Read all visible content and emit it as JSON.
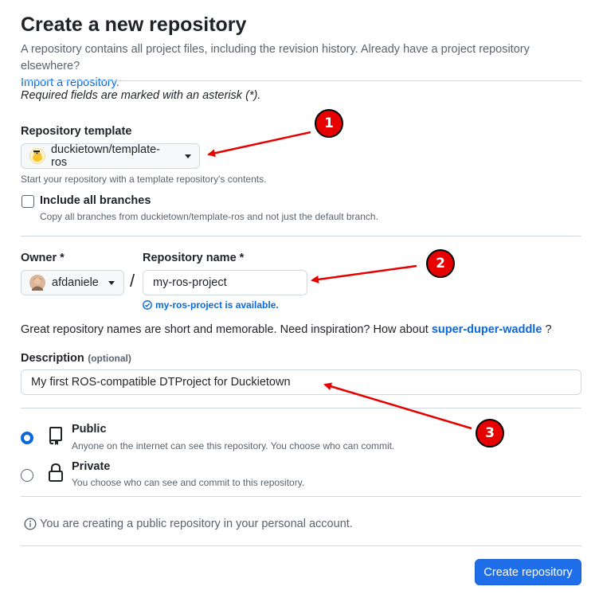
{
  "header": {
    "title": "Create a new repository",
    "intro": "A repository contains all project files, including the revision history. Already have a project repository elsewhere?",
    "import_link": "Import a repository."
  },
  "required_note": "Required fields are marked with an asterisk (*).",
  "template": {
    "label": "Repository template",
    "value": "duckietown/template-ros",
    "hint": "Start your repository with a template repository's contents.",
    "include_branches_label": "Include all branches",
    "include_branches_checked": false,
    "include_branches_hint": "Copy all branches from duckietown/template-ros and not just the default branch."
  },
  "owner": {
    "label": "Owner *",
    "value": "afdaniele"
  },
  "separator": "/",
  "repo_name": {
    "label": "Repository name *",
    "value": "my-ros-project",
    "availability": "my-ros-project is available."
  },
  "inspiration": {
    "text": "Great repository names are short and memorable. Need inspiration? How about",
    "suggestion": "super-duper-waddle",
    "suffix": "?"
  },
  "description": {
    "label": "Description",
    "optional": "(optional)",
    "value": "My first ROS-compatible DTProject for Duckietown"
  },
  "visibility": {
    "options": [
      {
        "label": "Public",
        "hint": "Anyone on the internet can see this repository. You choose who can commit.",
        "selected": true
      },
      {
        "label": "Private",
        "hint": "You choose who can see and commit to this repository.",
        "selected": false
      }
    ]
  },
  "info_note": "You are creating a public repository in your personal account.",
  "submit_label": "Create repository",
  "annotations": [
    "1",
    "2",
    "3"
  ],
  "colors": {
    "accent": "#0969da",
    "primary_button": "#1f6feb",
    "annotation": "#e60000",
    "success": "#1a7f37"
  }
}
